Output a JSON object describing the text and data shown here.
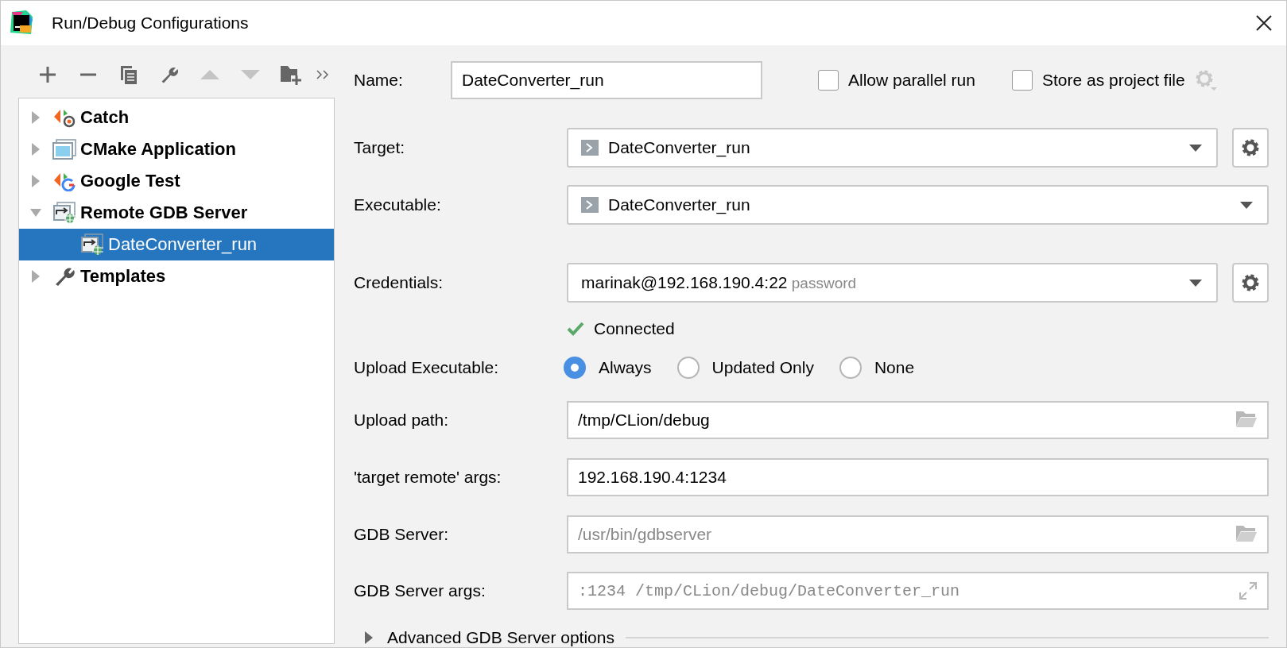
{
  "window": {
    "title": "Run/Debug Configurations"
  },
  "toolbar": [
    {
      "kind": "add",
      "disabled": false
    },
    {
      "kind": "remove",
      "disabled": false
    },
    {
      "kind": "copy",
      "disabled": false
    },
    {
      "kind": "edit",
      "disabled": false
    },
    {
      "kind": "up",
      "disabled": true
    },
    {
      "kind": "down",
      "disabled": true
    },
    {
      "kind": "folder",
      "disabled": false
    },
    {
      "kind": "more",
      "disabled": false
    }
  ],
  "tree": [
    {
      "label": "Catch",
      "kind": "catch",
      "expanded": false,
      "selected": false
    },
    {
      "label": "CMake Application",
      "kind": "cmake",
      "expanded": false,
      "selected": false
    },
    {
      "label": "Google Test",
      "kind": "gtest",
      "expanded": false,
      "selected": false
    },
    {
      "label": "Remote GDB Server",
      "kind": "remote",
      "expanded": true,
      "selected": false,
      "children": [
        {
          "label": "DateConverter_run",
          "kind": "remote",
          "selected": true
        }
      ]
    },
    {
      "label": "Templates",
      "kind": "templates",
      "expanded": false,
      "selected": false
    }
  ],
  "name_field": {
    "label": "Name:",
    "value": "DateConverter_run"
  },
  "options": [
    {
      "label": "Allow parallel run",
      "checked": false
    },
    {
      "label": "Store as project file",
      "checked": false
    }
  ],
  "rows": [
    {
      "kind": "dropdown",
      "label": "Target:",
      "value": "DateConverter_run",
      "run_icon": true,
      "gear": true
    },
    {
      "kind": "dropdown",
      "label": "Executable:",
      "value": "DateConverter_run",
      "run_icon": true,
      "gear": false
    },
    {
      "kind": "dropdown",
      "label": "Credentials:",
      "value": "marinak@192.168.190.4:22",
      "hint": "password",
      "run_icon": false,
      "gear": true
    },
    {
      "kind": "status",
      "text": "Connected"
    },
    {
      "kind": "radio",
      "label": "Upload Executable:",
      "options": [
        {
          "label": "Always",
          "selected": true
        },
        {
          "label": "Updated Only",
          "selected": false
        },
        {
          "label": "None",
          "selected": false
        }
      ]
    },
    {
      "kind": "path",
      "label": "Upload path:",
      "value": "/tmp/CLion/debug"
    },
    {
      "kind": "text",
      "label": "'target remote' args:",
      "value": "192.168.190.4:1234"
    },
    {
      "kind": "path",
      "label": "GDB Server:",
      "placeholder": "/usr/bin/gdbserver"
    },
    {
      "kind": "expand",
      "label": "GDB Server args:",
      "placeholder": ":1234 /tmp/CLion/debug/DateConverter_run"
    }
  ],
  "advanced": {
    "label": "Advanced GDB Server options",
    "expanded": false
  }
}
